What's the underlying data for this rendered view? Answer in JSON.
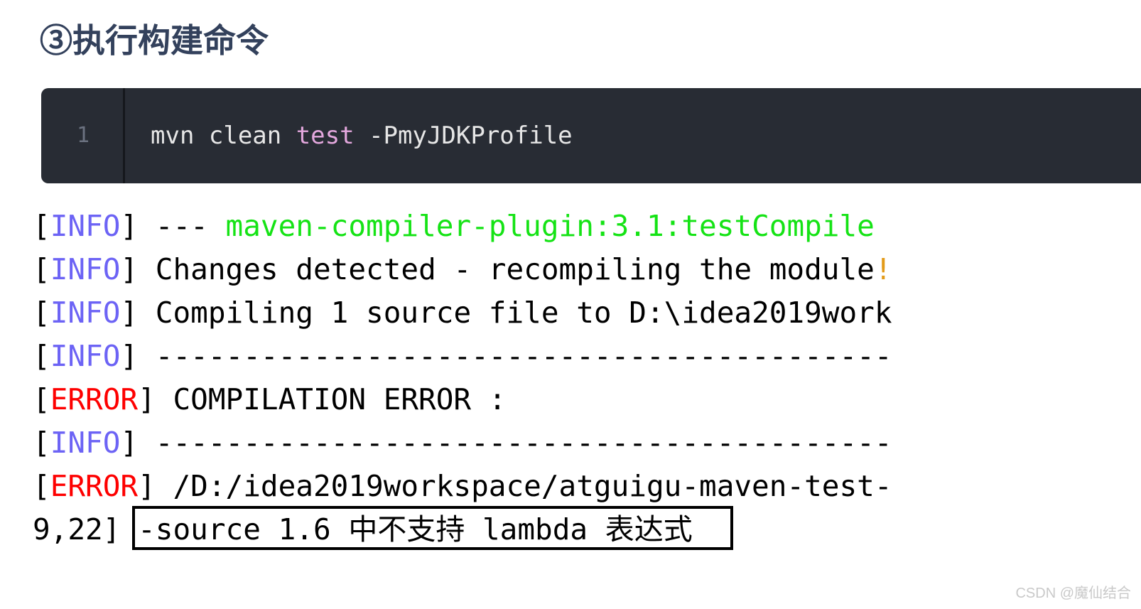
{
  "page": {
    "title": "③执行构建命令",
    "background_color": "#ffffff",
    "title_color": "#33415c"
  },
  "code_block": {
    "line_number": "1",
    "background_color": "#282c34",
    "gutter_color": "#6b7280",
    "keyword_color": "#e3a7dd",
    "command": {
      "prefix": "mvn clean ",
      "keyword": "test",
      "suffix": " -PmyJDKProfile"
    },
    "full_command": "mvn clean test -PmyJDKProfile"
  },
  "console": {
    "info_color": "#6c63f5",
    "error_color": "#fe0000",
    "goal_color": "#15e315",
    "lines": [
      {
        "bracket_open": "[",
        "level": "INFO",
        "bracket_close": "]",
        "message_plain": " --- ",
        "message_accent": "maven-compiler-plugin:3.1:testCompile",
        "message_tail": ""
      },
      {
        "bracket_open": "[",
        "level": "INFO",
        "bracket_close": "]",
        "message_plain": " Changes detected - recompiling the module",
        "message_accent": "",
        "message_tail": "!"
      },
      {
        "bracket_open": "[",
        "level": "INFO",
        "bracket_close": "]",
        "message_plain": " Compiling 1 source file to D:\\idea2019work",
        "message_accent": "",
        "message_tail": ""
      },
      {
        "bracket_open": "[",
        "level": "INFO",
        "bracket_close": "]",
        "message_plain": " ------------------------------------------",
        "message_accent": "",
        "message_tail": ""
      },
      {
        "bracket_open": "[",
        "level": "ERROR",
        "bracket_close": "]",
        "message_plain": " COMPILATION ERROR :",
        "message_accent": "",
        "message_tail": ""
      },
      {
        "bracket_open": "[",
        "level": "INFO",
        "bracket_close": "]",
        "message_plain": " ------------------------------------------",
        "message_accent": "",
        "message_tail": ""
      },
      {
        "bracket_open": "[",
        "level": "ERROR",
        "bracket_close": "]",
        "message_plain": " /D:/idea2019workspace/atguigu-maven-test-",
        "message_accent": "",
        "message_tail": ""
      },
      {
        "bracket_open": "",
        "level": "",
        "bracket_close": "",
        "message_plain": "9,22] -source 1.6 中不支持 lambda 表达式",
        "message_accent": "",
        "message_tail": ""
      }
    ]
  },
  "highlight_box": {
    "label": "-source 1.6 中不支持 lambda 表达式",
    "border_color": "#000000"
  },
  "watermark": {
    "text": "CSDN @魔仙结合"
  }
}
